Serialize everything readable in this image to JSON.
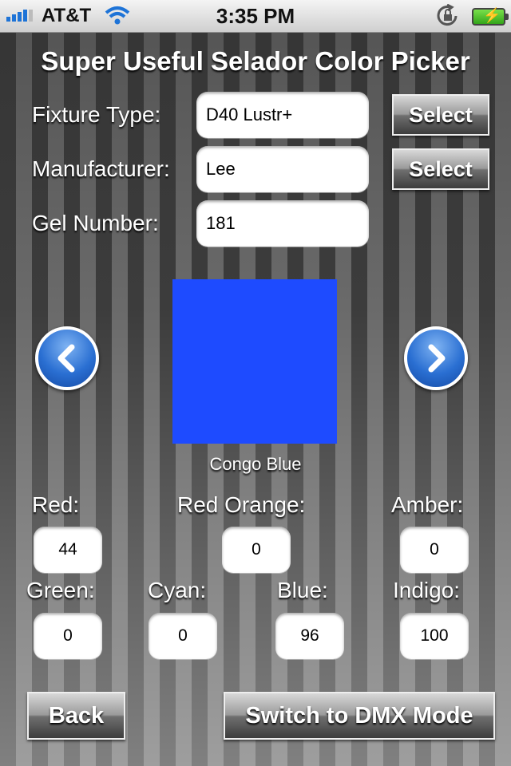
{
  "status_bar": {
    "carrier": "AT&T",
    "time": "3:35 PM"
  },
  "title": "Super Useful Selador Color Picker",
  "fixture": {
    "label": "Fixture Type:",
    "value": "D40 Lustr+",
    "button": "Select"
  },
  "manufacturer": {
    "label": "Manufacturer:",
    "value": "Lee",
    "button": "Select"
  },
  "gel": {
    "label": "Gel Number:",
    "value": "181"
  },
  "preview": {
    "color": "#1e4bff",
    "name": "Congo Blue"
  },
  "channels": {
    "red": {
      "label": "Red:",
      "value": "44"
    },
    "red_orange": {
      "label": "Red Orange:",
      "value": "0"
    },
    "amber": {
      "label": "Amber:",
      "value": "0"
    },
    "green": {
      "label": "Green:",
      "value": "0"
    },
    "cyan": {
      "label": "Cyan:",
      "value": "0"
    },
    "blue": {
      "label": "Blue:",
      "value": "96"
    },
    "indigo": {
      "label": "Indigo:",
      "value": "100"
    }
  },
  "footer": {
    "back": "Back",
    "switch": "Switch to DMX Mode"
  },
  "icons": [
    "signal-icon",
    "wifi-icon",
    "rotation-lock-icon",
    "battery-icon",
    "prev-arrow-icon",
    "next-arrow-icon"
  ]
}
